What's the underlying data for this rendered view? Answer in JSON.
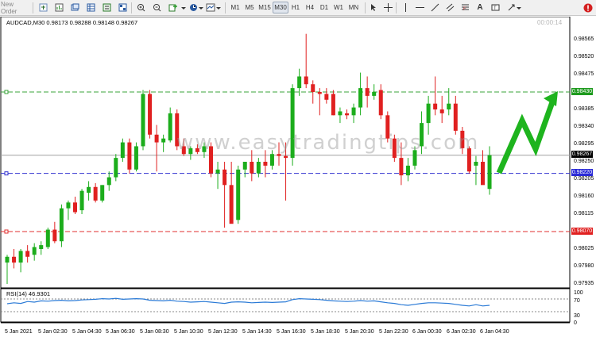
{
  "toolbar": {
    "new_order_label": "New Order",
    "timeframes": [
      "M1",
      "M5",
      "M15",
      "M30",
      "H1",
      "H4",
      "D1",
      "W1",
      "MN"
    ],
    "active_timeframe": "M30"
  },
  "chart_header": {
    "symbol_info": "AUDCAD,M30  0.98173 0.98288 0.98148 0.98267",
    "countdown": "00:00:14"
  },
  "watermark": "www.easytradingtips.com",
  "price_axis": {
    "labels": [
      "0.98565",
      "0.98520",
      "0.98475",
      "0.98385",
      "0.98340",
      "0.98295",
      "0.98250",
      "0.98205",
      "0.98160",
      "0.98115",
      "0.98025",
      "0.97980",
      "0.97935"
    ],
    "tags": [
      {
        "value": "0.98430",
        "color": "#1e9a1e"
      },
      {
        "value": "0.98267",
        "color": "#000000"
      },
      {
        "value": "0.98220",
        "color": "#2a2ad6"
      },
      {
        "value": "0.98070",
        "color": "#e02020"
      }
    ]
  },
  "horizontal_lines": [
    {
      "name": "resistance",
      "price": 0.9843,
      "color": "#3aa33a",
      "style": "dashed"
    },
    {
      "name": "current",
      "price": 0.98267,
      "color": "#a0a0a0",
      "style": "solid"
    },
    {
      "name": "entry",
      "price": 0.9822,
      "color": "#3030d0",
      "style": "dashed"
    },
    {
      "name": "support",
      "price": 0.9807,
      "color": "#e03030",
      "style": "dashed"
    }
  ],
  "time_axis": {
    "labels": [
      "5 Jan 2021",
      "5 Jan 02:30",
      "5 Jan 04:30",
      "5 Jan 06:30",
      "5 Jan 08:30",
      "5 Jan 10:30",
      "5 Jan 12:30",
      "5 Jan 14:30",
      "5 Jan 16:30",
      "5 Jan 18:30",
      "5 Jan 20:30",
      "5 Jan 22:30",
      "6 Jan 00:30",
      "6 Jan 02:30",
      "6 Jan 04:30"
    ]
  },
  "rsi": {
    "title": "RSI(14) 46.9301",
    "levels": [
      "70",
      "30"
    ],
    "axis_labels": [
      "100",
      "70",
      "30",
      "0"
    ]
  },
  "chart_data": {
    "type": "candlestick",
    "symbol": "AUDCAD",
    "timeframe": "M30",
    "ylim": [
      0.97935,
      0.98585
    ],
    "candles": [
      {
        "o": 0.9799,
        "h": 0.9801,
        "l": 0.97935,
        "c": 0.98005
      },
      {
        "o": 0.98005,
        "h": 0.98025,
        "l": 0.97975,
        "c": 0.9799
      },
      {
        "o": 0.9799,
        "h": 0.98025,
        "l": 0.97965,
        "c": 0.9802
      },
      {
        "o": 0.9802,
        "h": 0.98035,
        "l": 0.9799,
        "c": 0.98005
      },
      {
        "o": 0.9801,
        "h": 0.9804,
        "l": 0.97995,
        "c": 0.9803
      },
      {
        "o": 0.98025,
        "h": 0.98045,
        "l": 0.9801,
        "c": 0.98035
      },
      {
        "o": 0.9803,
        "h": 0.9808,
        "l": 0.98025,
        "c": 0.98075
      },
      {
        "o": 0.98075,
        "h": 0.98095,
        "l": 0.9804,
        "c": 0.98045
      },
      {
        "o": 0.98045,
        "h": 0.9814,
        "l": 0.9803,
        "c": 0.9813
      },
      {
        "o": 0.9813,
        "h": 0.9815,
        "l": 0.981,
        "c": 0.98145
      },
      {
        "o": 0.98145,
        "h": 0.9816,
        "l": 0.98115,
        "c": 0.9812
      },
      {
        "o": 0.98125,
        "h": 0.9818,
        "l": 0.98115,
        "c": 0.98175
      },
      {
        "o": 0.9817,
        "h": 0.982,
        "l": 0.9815,
        "c": 0.98185
      },
      {
        "o": 0.98185,
        "h": 0.98195,
        "l": 0.98145,
        "c": 0.9815
      },
      {
        "o": 0.9815,
        "h": 0.9819,
        "l": 0.98145,
        "c": 0.9819
      },
      {
        "o": 0.9819,
        "h": 0.98225,
        "l": 0.98175,
        "c": 0.9821
      },
      {
        "o": 0.9821,
        "h": 0.9827,
        "l": 0.982,
        "c": 0.9826
      },
      {
        "o": 0.9826,
        "h": 0.9831,
        "l": 0.9825,
        "c": 0.983
      },
      {
        "o": 0.983,
        "h": 0.9831,
        "l": 0.9822,
        "c": 0.9823
      },
      {
        "o": 0.9823,
        "h": 0.983,
        "l": 0.98225,
        "c": 0.9829
      },
      {
        "o": 0.9829,
        "h": 0.98435,
        "l": 0.9828,
        "c": 0.98425
      },
      {
        "o": 0.98425,
        "h": 0.98435,
        "l": 0.9831,
        "c": 0.9832
      },
      {
        "o": 0.9832,
        "h": 0.98345,
        "l": 0.98225,
        "c": 0.983
      },
      {
        "o": 0.983,
        "h": 0.9832,
        "l": 0.98275,
        "c": 0.9831
      },
      {
        "o": 0.98305,
        "h": 0.9839,
        "l": 0.983,
        "c": 0.98375
      },
      {
        "o": 0.98375,
        "h": 0.98385,
        "l": 0.9828,
        "c": 0.9829
      },
      {
        "o": 0.9829,
        "h": 0.9831,
        "l": 0.98265,
        "c": 0.9827
      },
      {
        "o": 0.9827,
        "h": 0.9829,
        "l": 0.98255,
        "c": 0.98285
      },
      {
        "o": 0.98285,
        "h": 0.98295,
        "l": 0.9827,
        "c": 0.98275
      },
      {
        "o": 0.98275,
        "h": 0.983,
        "l": 0.9826,
        "c": 0.9829
      },
      {
        "o": 0.9829,
        "h": 0.983,
        "l": 0.9821,
        "c": 0.9822
      },
      {
        "o": 0.9822,
        "h": 0.9825,
        "l": 0.9818,
        "c": 0.9823
      },
      {
        "o": 0.9823,
        "h": 0.9825,
        "l": 0.9808,
        "c": 0.9819
      },
      {
        "o": 0.9819,
        "h": 0.9825,
        "l": 0.981,
        "c": 0.9809
      },
      {
        "o": 0.981,
        "h": 0.9824,
        "l": 0.9809,
        "c": 0.9823
      },
      {
        "o": 0.9823,
        "h": 0.9825,
        "l": 0.9821,
        "c": 0.9825
      },
      {
        "o": 0.9825,
        "h": 0.9828,
        "l": 0.982,
        "c": 0.9822
      },
      {
        "o": 0.9822,
        "h": 0.9826,
        "l": 0.9821,
        "c": 0.9825
      },
      {
        "o": 0.9825,
        "h": 0.9828,
        "l": 0.9821,
        "c": 0.9824
      },
      {
        "o": 0.9824,
        "h": 0.9828,
        "l": 0.9823,
        "c": 0.9827
      },
      {
        "o": 0.9827,
        "h": 0.983,
        "l": 0.9824,
        "c": 0.98265
      },
      {
        "o": 0.98265,
        "h": 0.983,
        "l": 0.9815,
        "c": 0.9826
      },
      {
        "o": 0.9826,
        "h": 0.9845,
        "l": 0.9824,
        "c": 0.9844
      },
      {
        "o": 0.9844,
        "h": 0.9849,
        "l": 0.9842,
        "c": 0.9847
      },
      {
        "o": 0.9847,
        "h": 0.9858,
        "l": 0.9844,
        "c": 0.9845
      },
      {
        "o": 0.9845,
        "h": 0.9846,
        "l": 0.984,
        "c": 0.9843
      },
      {
        "o": 0.9843,
        "h": 0.9844,
        "l": 0.9837,
        "c": 0.98425
      },
      {
        "o": 0.98425,
        "h": 0.9844,
        "l": 0.984,
        "c": 0.9841
      },
      {
        "o": 0.98425,
        "h": 0.98435,
        "l": 0.9837,
        "c": 0.9837
      },
      {
        "o": 0.9837,
        "h": 0.9839,
        "l": 0.9835,
        "c": 0.9838
      },
      {
        "o": 0.98375,
        "h": 0.98385,
        "l": 0.9836,
        "c": 0.9837
      },
      {
        "o": 0.9837,
        "h": 0.984,
        "l": 0.9835,
        "c": 0.9839
      },
      {
        "o": 0.9839,
        "h": 0.9848,
        "l": 0.9837,
        "c": 0.9844
      },
      {
        "o": 0.9844,
        "h": 0.9847,
        "l": 0.9839,
        "c": 0.9842
      },
      {
        "o": 0.9842,
        "h": 0.9845,
        "l": 0.9841,
        "c": 0.9843
      },
      {
        "o": 0.98435,
        "h": 0.9845,
        "l": 0.9836,
        "c": 0.9837
      },
      {
        "o": 0.9837,
        "h": 0.9838,
        "l": 0.983,
        "c": 0.9831
      },
      {
        "o": 0.9831,
        "h": 0.9832,
        "l": 0.9825,
        "c": 0.9826
      },
      {
        "o": 0.9826,
        "h": 0.983,
        "l": 0.9819,
        "c": 0.98215
      },
      {
        "o": 0.98215,
        "h": 0.9826,
        "l": 0.982,
        "c": 0.9824
      },
      {
        "o": 0.9824,
        "h": 0.9829,
        "l": 0.9823,
        "c": 0.9828
      },
      {
        "o": 0.9829,
        "h": 0.9838,
        "l": 0.9827,
        "c": 0.9835
      },
      {
        "o": 0.9835,
        "h": 0.9842,
        "l": 0.9832,
        "c": 0.984
      },
      {
        "o": 0.984,
        "h": 0.9847,
        "l": 0.9837,
        "c": 0.98385
      },
      {
        "o": 0.98385,
        "h": 0.9842,
        "l": 0.9835,
        "c": 0.98375
      },
      {
        "o": 0.98385,
        "h": 0.9844,
        "l": 0.9837,
        "c": 0.984
      },
      {
        "o": 0.984,
        "h": 0.9842,
        "l": 0.9832,
        "c": 0.9833
      },
      {
        "o": 0.9833,
        "h": 0.9834,
        "l": 0.9827,
        "c": 0.98285
      },
      {
        "o": 0.98285,
        "h": 0.9829,
        "l": 0.9822,
        "c": 0.98225
      },
      {
        "o": 0.9824,
        "h": 0.98265,
        "l": 0.9819,
        "c": 0.9825
      },
      {
        "o": 0.9825,
        "h": 0.9828,
        "l": 0.982,
        "c": 0.9819
      },
      {
        "o": 0.9818,
        "h": 0.9829,
        "l": 0.98165,
        "c": 0.98267
      }
    ],
    "rsi_values": [
      55,
      58,
      56,
      62,
      60,
      64,
      63,
      65,
      66,
      64,
      65,
      67,
      68,
      69,
      71,
      70,
      72,
      69,
      70,
      71,
      70,
      66,
      65,
      64,
      66,
      63,
      62,
      60,
      61,
      62,
      60,
      58,
      56,
      60,
      61,
      60,
      58,
      59,
      60,
      59,
      60,
      61,
      68,
      71,
      70,
      69,
      68,
      66,
      64,
      63,
      62,
      63,
      65,
      63,
      64,
      61,
      58,
      56,
      52,
      50,
      53,
      56,
      58,
      58,
      57,
      56,
      53,
      50,
      48,
      52,
      48,
      50
    ],
    "arrow": {
      "color": "#1eb41e"
    }
  }
}
